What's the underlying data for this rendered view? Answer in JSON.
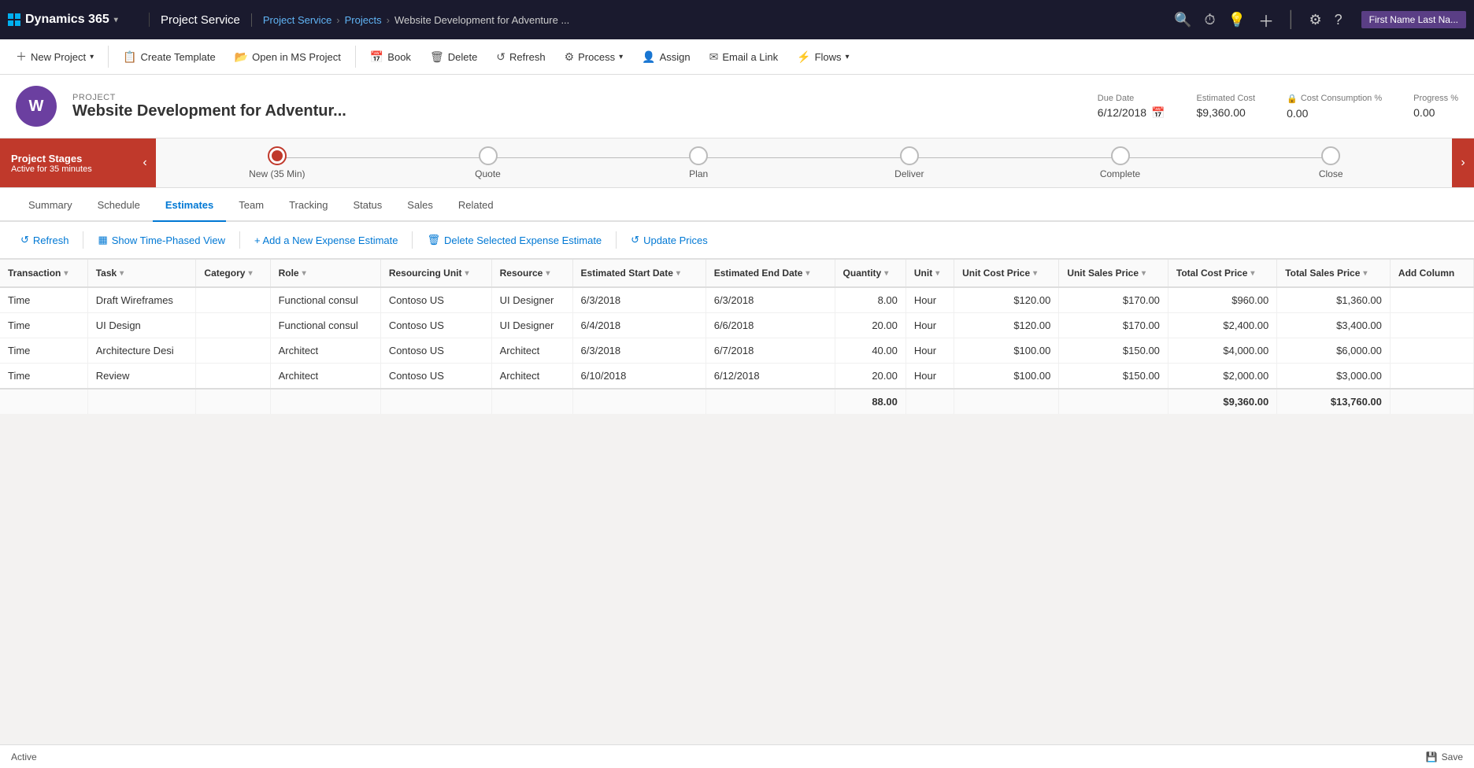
{
  "app": {
    "brand": "Dynamics 365",
    "module": "Project Service",
    "breadcrumb": [
      "Project Service",
      "Projects",
      "Website Development for Adventure ..."
    ],
    "user": "First Name Last Na..."
  },
  "cmdbar": {
    "buttons": [
      {
        "id": "new-project",
        "label": "New Project",
        "icon": "＋",
        "hasDropdown": true
      },
      {
        "id": "create-template",
        "label": "Create Template",
        "icon": "📋"
      },
      {
        "id": "open-ms-project",
        "label": "Open in MS Project",
        "icon": "📂"
      },
      {
        "id": "book",
        "label": "Book",
        "icon": "📅"
      },
      {
        "id": "delete",
        "label": "Delete",
        "icon": "🗑"
      },
      {
        "id": "refresh",
        "label": "Refresh",
        "icon": "↺"
      },
      {
        "id": "process",
        "label": "Process",
        "icon": "⚙",
        "hasDropdown": true
      },
      {
        "id": "assign",
        "label": "Assign",
        "icon": "👤"
      },
      {
        "id": "email-link",
        "label": "Email a Link",
        "icon": "✉"
      },
      {
        "id": "flows",
        "label": "Flows",
        "icon": "⚡",
        "hasDropdown": true
      }
    ]
  },
  "project": {
    "label": "PROJECT",
    "title": "Website Development for Adventur...",
    "icon_letter": "W",
    "due_date_label": "Due Date",
    "due_date": "6/12/2018",
    "estimated_cost_label": "Estimated Cost",
    "estimated_cost": "$9,360.00",
    "cost_consumption_label": "Cost Consumption %",
    "cost_consumption": "0.00",
    "progress_label": "Progress %",
    "progress": "0.00"
  },
  "stages": {
    "label": "Project Stages",
    "sub_label": "Active for 35 minutes",
    "items": [
      {
        "id": "new",
        "label": "New  (35 Min)",
        "active": true
      },
      {
        "id": "quote",
        "label": "Quote",
        "active": false
      },
      {
        "id": "plan",
        "label": "Plan",
        "active": false
      },
      {
        "id": "deliver",
        "label": "Deliver",
        "active": false
      },
      {
        "id": "complete",
        "label": "Complete",
        "active": false
      },
      {
        "id": "close",
        "label": "Close",
        "active": false
      }
    ]
  },
  "tabs": [
    {
      "id": "summary",
      "label": "Summary",
      "active": false
    },
    {
      "id": "schedule",
      "label": "Schedule",
      "active": false
    },
    {
      "id": "estimates",
      "label": "Estimates",
      "active": true
    },
    {
      "id": "team",
      "label": "Team",
      "active": false
    },
    {
      "id": "tracking",
      "label": "Tracking",
      "active": false
    },
    {
      "id": "status",
      "label": "Status",
      "active": false
    },
    {
      "id": "sales",
      "label": "Sales",
      "active": false
    },
    {
      "id": "related",
      "label": "Related",
      "active": false
    }
  ],
  "estimates": {
    "toolbar": {
      "refresh": "Refresh",
      "show_time_phased": "Show Time-Phased View",
      "add_expense": "+ Add a New Expense Estimate",
      "delete_expense": "Delete Selected Expense Estimate",
      "update_prices": "Update Prices"
    },
    "columns": [
      "Transaction",
      "Task",
      "Category",
      "Role",
      "Resourcing Unit",
      "Resource",
      "Estimated Start Date",
      "Estimated End Date",
      "Quantity",
      "Unit",
      "Unit Cost Price",
      "Unit Sales Price",
      "Total Cost Price",
      "Total Sales Price",
      "Add Column"
    ],
    "rows": [
      {
        "transaction": "Time",
        "task": "Draft Wireframes",
        "category": "",
        "role": "Functional consul",
        "resourcing_unit": "Contoso US",
        "resource": "UI Designer",
        "start_date": "6/3/2018",
        "end_date": "6/3/2018",
        "quantity": "8.00",
        "unit": "Hour",
        "unit_cost_price": "$120.00",
        "unit_sales_price": "$170.00",
        "total_cost_price": "$960.00",
        "total_sales_price": "$1,360.00"
      },
      {
        "transaction": "Time",
        "task": "UI Design",
        "category": "",
        "role": "Functional consul",
        "resourcing_unit": "Contoso US",
        "resource": "UI Designer",
        "start_date": "6/4/2018",
        "end_date": "6/6/2018",
        "quantity": "20.00",
        "unit": "Hour",
        "unit_cost_price": "$120.00",
        "unit_sales_price": "$170.00",
        "total_cost_price": "$2,400.00",
        "total_sales_price": "$3,400.00"
      },
      {
        "transaction": "Time",
        "task": "Architecture Desi",
        "category": "",
        "role": "Architect",
        "resourcing_unit": "Contoso US",
        "resource": "Architect",
        "start_date": "6/3/2018",
        "end_date": "6/7/2018",
        "quantity": "40.00",
        "unit": "Hour",
        "unit_cost_price": "$100.00",
        "unit_sales_price": "$150.00",
        "total_cost_price": "$4,000.00",
        "total_sales_price": "$6,000.00"
      },
      {
        "transaction": "Time",
        "task": "Review",
        "category": "",
        "role": "Architect",
        "resourcing_unit": "Contoso US",
        "resource": "Architect",
        "start_date": "6/10/2018",
        "end_date": "6/12/2018",
        "quantity": "20.00",
        "unit": "Hour",
        "unit_cost_price": "$100.00",
        "unit_sales_price": "$150.00",
        "total_cost_price": "$2,000.00",
        "total_sales_price": "$3,000.00"
      }
    ],
    "footer": {
      "quantity_total": "88.00",
      "total_cost_price": "$9,360.00",
      "total_sales_price": "$13,760.00"
    }
  },
  "status_bar": {
    "status": "Active",
    "save_label": "Save"
  }
}
